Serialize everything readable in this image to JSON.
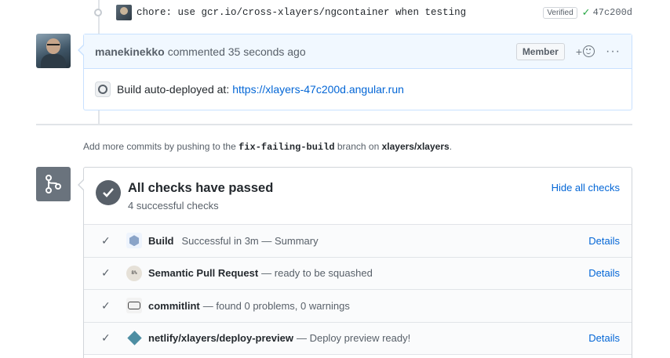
{
  "commit": {
    "message": "chore: use gcr.io/cross-xlayers/ngcontainer when testing",
    "verified": "Verified",
    "sha": "47c200d"
  },
  "comment": {
    "author": "manekinekko",
    "action": "commented 35 seconds ago",
    "badge": "Member",
    "reaction_plus": "+",
    "more": "···",
    "body_text": "Build auto-deployed at:",
    "link_text": "https://xlayers-47c200d.angular.run"
  },
  "hint": {
    "prefix": "Add more commits by pushing to the",
    "branch": "fix-failing-build",
    "middle": "branch on",
    "repo": "xlayers/xlayers",
    "suffix": "."
  },
  "checks": {
    "title": "All checks have passed",
    "subtitle": "4 successful checks",
    "hide_label": "Hide all checks",
    "items": [
      {
        "name": "Build",
        "desc": "Successful in 3m — Summary",
        "details": "Details",
        "icon": "gcb-icon"
      },
      {
        "name": "Semantic Pull Request",
        "desc": "— ready to be squashed",
        "details": "Details",
        "icon": "semantic-pr-icon"
      },
      {
        "name": "commitlint",
        "desc": "— found 0 problems, 0 warnings",
        "details": "",
        "icon": "commitlint-icon"
      },
      {
        "name": "netlify/xlayers/deploy-preview",
        "desc": "— Deploy preview ready!",
        "details": "Details",
        "icon": "netlify-icon"
      }
    ]
  },
  "colors": {
    "link": "#0366d6",
    "verified_check": "#28a745",
    "comment_header_bg": "#f1f8ff",
    "comment_border": "#c8e1ff"
  }
}
